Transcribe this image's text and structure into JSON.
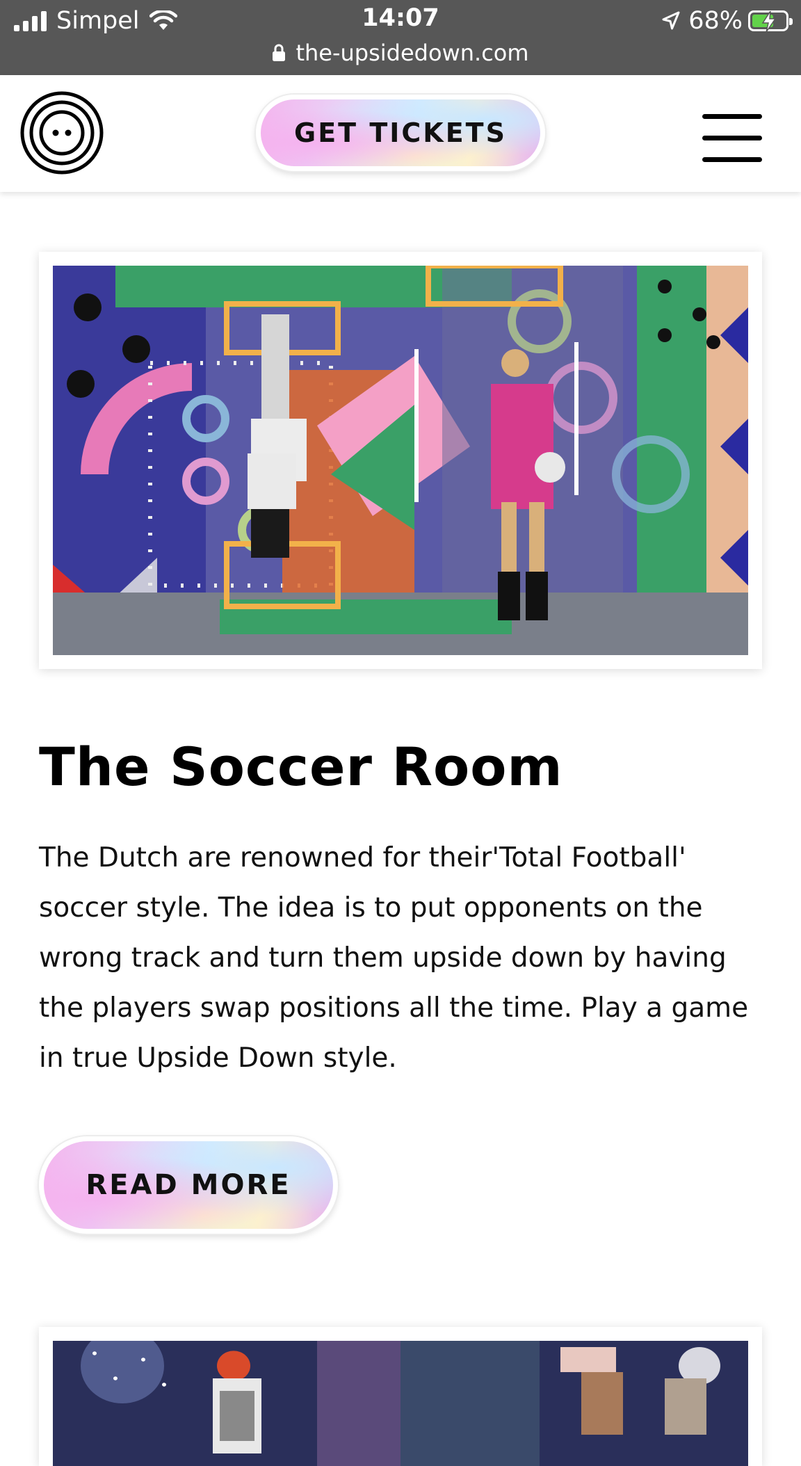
{
  "status_bar": {
    "carrier": "Simpel",
    "time": "14:07",
    "battery_percent": "68%",
    "battery_level": 0.68,
    "icons": [
      "signal-icon",
      "wifi-icon",
      "location-icon",
      "battery-charging-icon"
    ]
  },
  "browser": {
    "url": "the-upsidedown.com",
    "icon": "lock-icon"
  },
  "header": {
    "logo_icon": "concentric-circles-logo",
    "tickets_label": "GET TICKETS",
    "menu_icon": "hamburger-menu-icon"
  },
  "article": {
    "image_alt": "photo-soccer-room",
    "title": "The Soccer Room",
    "description": "The Dutch are renowned for their'Total Football' soccer style. The idea is to put opponents on the wrong track and turn them upside down by having the players swap positions all the time. Play a game in true Upside Down style.",
    "read_more_label": "READ MORE"
  },
  "next_article": {
    "image_alt": "photo-next-room"
  },
  "colors": {
    "status_bar_bg": "#575757",
    "battery_green": "#62d24a",
    "pill_pink": "#f4b5ee",
    "pill_blue": "#d4ecff",
    "pill_cream": "#f9efd6"
  }
}
